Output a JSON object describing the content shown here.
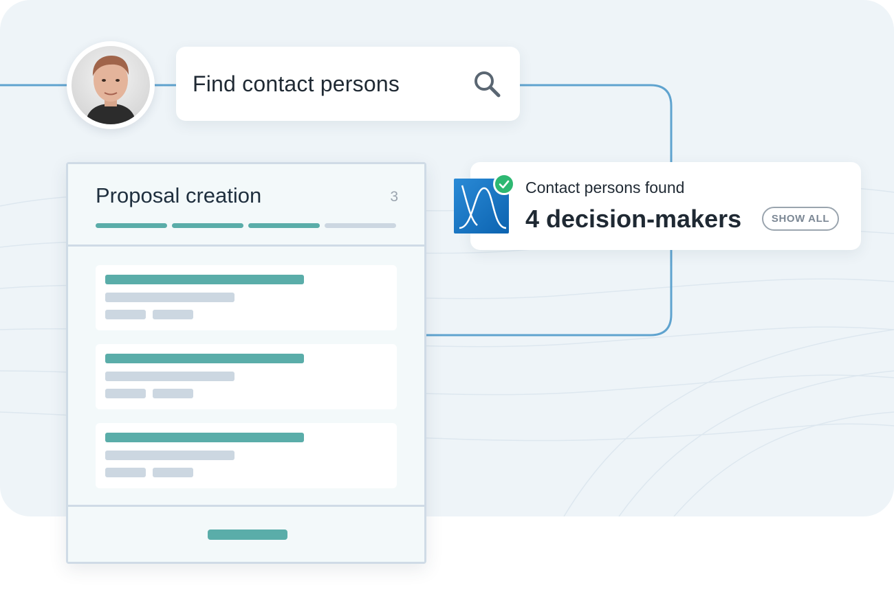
{
  "search": {
    "text": "Find contact persons",
    "icon": "search-icon"
  },
  "avatar": {
    "icon": "user-avatar"
  },
  "result": {
    "label": "Contact persons found",
    "value": "4 decision-makers",
    "show_all_label": "SHOW ALL",
    "app_icon": "bell-curve-app-icon",
    "status_icon": "check-icon"
  },
  "proposal": {
    "title": "Proposal creation",
    "count": "3",
    "progress": {
      "completed_steps": 3,
      "total_steps": 4
    },
    "items": 3
  },
  "colors": {
    "accent_teal": "#5aada9",
    "placeholder_gray": "#ccd7e1",
    "connector_blue": "#5fa3cf",
    "success_green": "#2eb872",
    "app_blue": "#0c63b0",
    "background": "#eef4f8"
  }
}
